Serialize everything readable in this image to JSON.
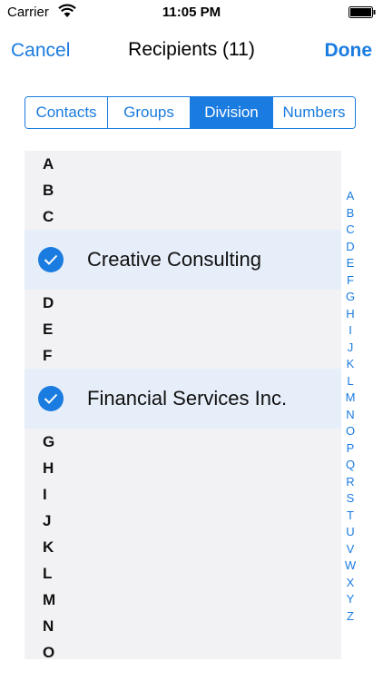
{
  "status_bar": {
    "carrier": "Carrier",
    "time": "11:05 PM"
  },
  "nav": {
    "cancel_label": "Cancel",
    "title": "Recipients (11)",
    "done_label": "Done"
  },
  "segments": [
    {
      "label": "Contacts",
      "active": false
    },
    {
      "label": "Groups",
      "active": false
    },
    {
      "label": "Division",
      "active": true
    },
    {
      "label": "Numbers",
      "active": false
    }
  ],
  "list": {
    "letters_top": [
      "A",
      "B",
      "C"
    ],
    "selected_1": "Creative Consulting",
    "letters_mid": [
      "D",
      "E",
      "F"
    ],
    "selected_2": "Financial Services Inc.",
    "letters_bottom": [
      "G",
      "H",
      "I",
      "J",
      "K",
      "L",
      "M",
      "N",
      "O"
    ]
  },
  "index": [
    "A",
    "B",
    "C",
    "D",
    "E",
    "F",
    "G",
    "H",
    "I",
    "J",
    "K",
    "L",
    "M",
    "N",
    "O",
    "P",
    "Q",
    "R",
    "S",
    "T",
    "U",
    "V",
    "W",
    "X",
    "Y",
    "Z"
  ],
  "colors": {
    "accent": "#1a7be0",
    "selected_row": "#e6eef9",
    "list_bg": "#f2f2f4"
  },
  "icons": {
    "wifi": "wifi-icon",
    "battery": "battery-icon",
    "check": "checkmark-circle-icon"
  }
}
